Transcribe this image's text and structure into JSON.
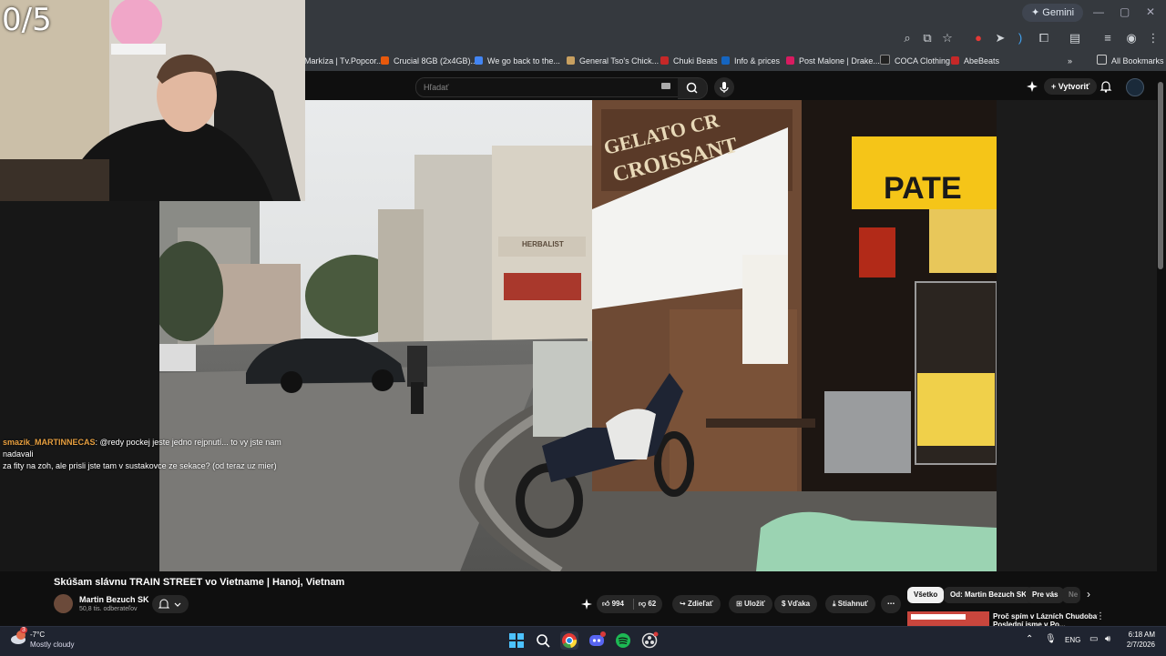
{
  "browser": {
    "gemini_label": "Gemini",
    "bookmarks": [
      {
        "label": "Markíza | Tv.Popcor...",
        "color": "#2a2a2a"
      },
      {
        "label": "Crucial 8GB (2x4GB)...",
        "color": "#e8590c"
      },
      {
        "label": "We go back to the...",
        "color": "#4285f4"
      },
      {
        "label": "General Tso's Chick...",
        "color": "#c8a060"
      },
      {
        "label": "Chuki Beats",
        "color": "#c62828"
      },
      {
        "label": "Info & prices",
        "color": "#1565c0"
      },
      {
        "label": "Post Malone | Drake...",
        "color": "#d81b60"
      },
      {
        "label": "COCA Clothing",
        "color": "#222222"
      },
      {
        "label": "AbeBeats",
        "color": "#c62828"
      }
    ],
    "all_bookmarks_label": "All Bookmarks"
  },
  "youtube": {
    "search_placeholder": "Hľadať",
    "create_label": "Vytvoriť",
    "video_title": "Skúšam slávnu TRAIN STREET vo Vietname | Hanoj, Vietnam",
    "channel_name": "Martin Bezuch SK",
    "subscribers": "50,8 tis. odberateľov",
    "likes": "994",
    "dislikes": "62",
    "share_label": "Zdieľať",
    "save_label": "Uložiť",
    "thanks_label": "Vďaka",
    "download_label": "Stiahnuť",
    "filter_chips": [
      "Všetko",
      "Od: Martin Bezuch SK",
      "Pre vás",
      "Ne"
    ],
    "rec_title": "Proč spím v Lázních Chudoba? |",
    "rec_title_2": "Poslední jsme v Po..."
  },
  "stream": {
    "fps_counter": "0/5",
    "chat_user": "smazik_MARTINNECAS",
    "chat_message_line1": ": @redy pockej jeste jedno rejpnutí... to vy jste nam nadavali",
    "chat_message_line2": "za fity na zoh, ale prisli jste tam v sustakovce ze sekace? (od teraz uz mier)"
  },
  "video_signs": {
    "sign1": "GELATO CR",
    "sign2": "CROISSANT",
    "sign3": "PATE",
    "sign4": "HERBALIST"
  },
  "taskbar": {
    "temperature": "-7°C",
    "weather": "Mostly cloudy",
    "language": "ENG",
    "time": "6:18 AM",
    "date": "2/7/2026",
    "badge_count": "3"
  }
}
